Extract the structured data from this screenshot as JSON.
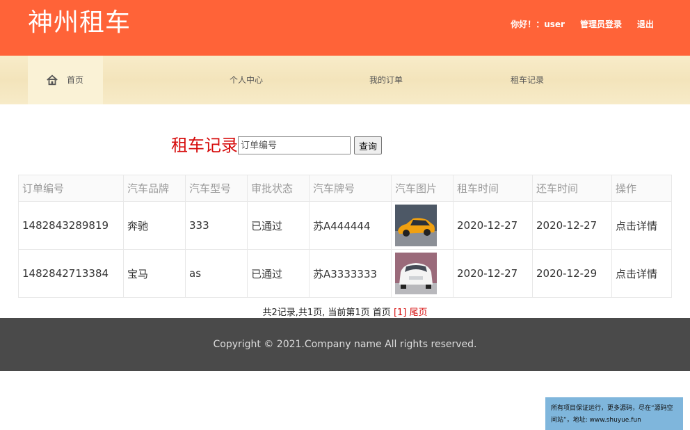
{
  "header": {
    "logo": "神州租车",
    "greeting": "你好！：user",
    "admin_login": "管理员登录",
    "logout": "退出"
  },
  "nav": {
    "home": "首页",
    "center": "个人中心",
    "orders": "我的订单",
    "records": "租车记录"
  },
  "search": {
    "title": "租车记录",
    "placeholder": "订单编号",
    "button": "查询"
  },
  "table": {
    "headers": [
      "订单编号",
      "汽车品牌",
      "汽车型号",
      "审批状态",
      "汽车牌号",
      "汽车图片",
      "租车时间",
      "还车时间",
      "操作"
    ],
    "rows": [
      [
        "1482843289819",
        "奔驰",
        "333",
        "已通过",
        "苏A444444",
        "",
        "2020-12-27",
        "2020-12-27",
        "点击详情"
      ],
      [
        "1482842713384",
        "宝马",
        "as",
        "已通过",
        "苏A3333333",
        "",
        "2020-12-27",
        "2020-12-29",
        "点击详情"
      ]
    ]
  },
  "pager": {
    "summary": "共2记录,共1页, 当前第1页 首页",
    "current": "[1]",
    "last": "尾页"
  },
  "footer": {
    "copyright": "Copyright © 2021.Company name All rights reserved."
  },
  "notice": {
    "text": "所有项目保证运行，更多源码，尽在“源码空间站”，地址: www.shuyue.fun"
  }
}
